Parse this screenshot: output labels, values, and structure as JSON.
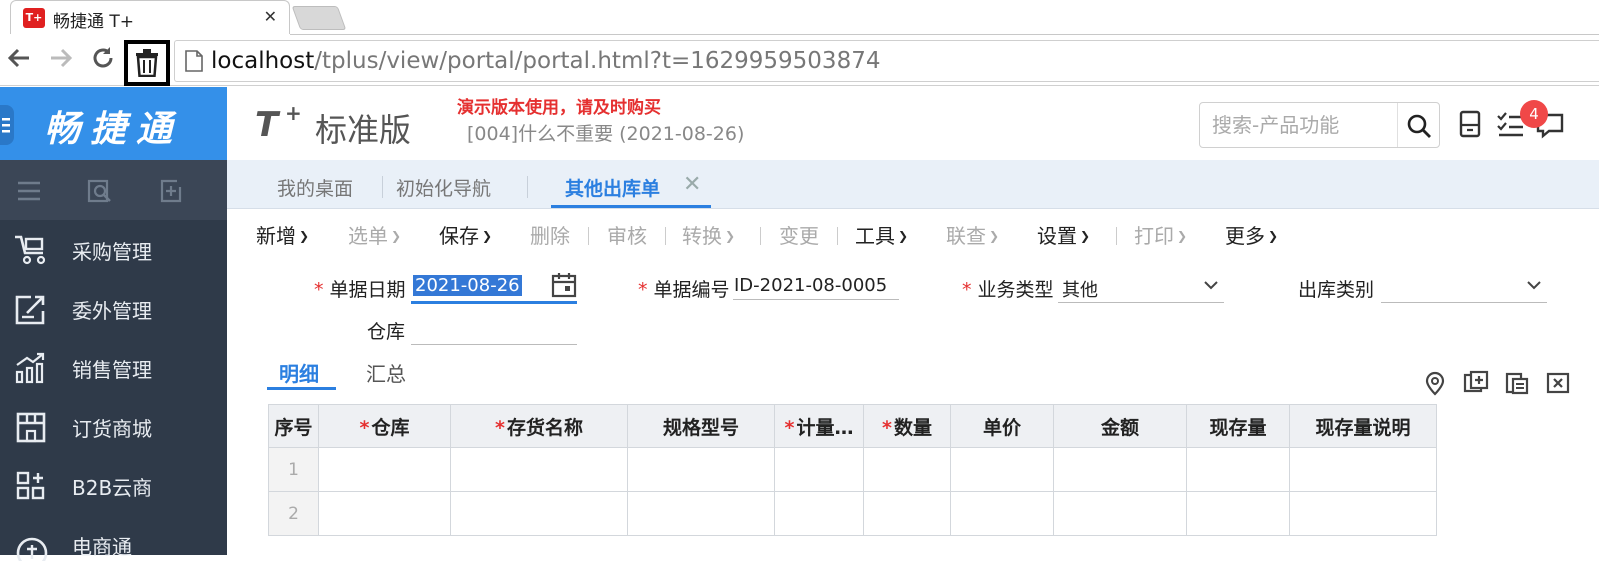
{
  "browser": {
    "tab_title": "畅捷通 T+",
    "tab_close": "✕",
    "favicon_text": "T+",
    "url_host": "localhost",
    "url_path": "/tplus/view/portal/portal.html?t=1629959503874"
  },
  "sidebar": {
    "brand": "畅捷通",
    "items": [
      {
        "label": "采购管理",
        "icon": "cart-icon"
      },
      {
        "label": "委外管理",
        "icon": "outsource-icon"
      },
      {
        "label": "销售管理",
        "icon": "sales-chart-icon"
      },
      {
        "label": "订货商城",
        "icon": "store-icon"
      },
      {
        "label": "B2B云商",
        "icon": "b2b-grid-icon"
      },
      {
        "label": "电商通",
        "icon": "ecommerce-icon"
      }
    ],
    "colors": {
      "brand_bg": "#3490e9",
      "nav_bg": "#2f3a49"
    }
  },
  "header": {
    "logo_t": "T",
    "logo_plus": "+",
    "edition": "标准版",
    "demo_warning": "演示版本使用，请及时购买",
    "account": "[004]什么不重要   (2021-08-26)",
    "search_placeholder": "搜索-产品功能",
    "notification_count": "4"
  },
  "page_tabs": [
    {
      "label": "我的桌面",
      "active": false
    },
    {
      "label": "初始化导航",
      "active": false
    },
    {
      "label": "其他出库单",
      "active": true,
      "close": "✕"
    }
  ],
  "actions": [
    {
      "label": "新增",
      "enabled": true,
      "dropdown": true
    },
    {
      "label": "选单",
      "enabled": false,
      "dropdown": true
    },
    {
      "label": "保存",
      "enabled": true,
      "dropdown": true
    },
    {
      "label": "删除",
      "enabled": false,
      "dropdown": false
    },
    {
      "label": "审核",
      "enabled": false,
      "dropdown": false
    },
    {
      "label": "转换",
      "enabled": false,
      "dropdown": true
    },
    {
      "label": "变更",
      "enabled": false,
      "dropdown": false
    },
    {
      "label": "工具",
      "enabled": true,
      "dropdown": true
    },
    {
      "label": "联查",
      "enabled": false,
      "dropdown": true
    },
    {
      "label": "设置",
      "enabled": true,
      "dropdown": true
    },
    {
      "label": "打印",
      "enabled": false,
      "dropdown": true
    },
    {
      "label": "更多",
      "enabled": true,
      "dropdown": true
    }
  ],
  "form": {
    "required_mark": "*",
    "date_label": "单据日期",
    "date_value": "2021-08-26",
    "code_label": "单据编号",
    "code_value": "ID-2021-08-0005",
    "biz_type_label": "业务类型",
    "biz_type_value": "其他",
    "out_type_label": "出库类别",
    "out_type_value": "",
    "warehouse_label": "仓库",
    "warehouse_value": ""
  },
  "detail_tabs": [
    {
      "label": "明细",
      "active": true
    },
    {
      "label": "汇总",
      "active": false
    }
  ],
  "grid": {
    "columns": [
      {
        "label": "序号",
        "required": false
      },
      {
        "label": "仓库",
        "required": true
      },
      {
        "label": "存货名称",
        "required": true
      },
      {
        "label": "规格型号",
        "required": false
      },
      {
        "label": "计量…",
        "required": true
      },
      {
        "label": "数量",
        "required": true
      },
      {
        "label": "单价",
        "required": false
      },
      {
        "label": "金额",
        "required": false
      },
      {
        "label": "现存量",
        "required": false
      },
      {
        "label": "现存量说明",
        "required": false
      }
    ],
    "rows": [
      "1",
      "2"
    ]
  }
}
